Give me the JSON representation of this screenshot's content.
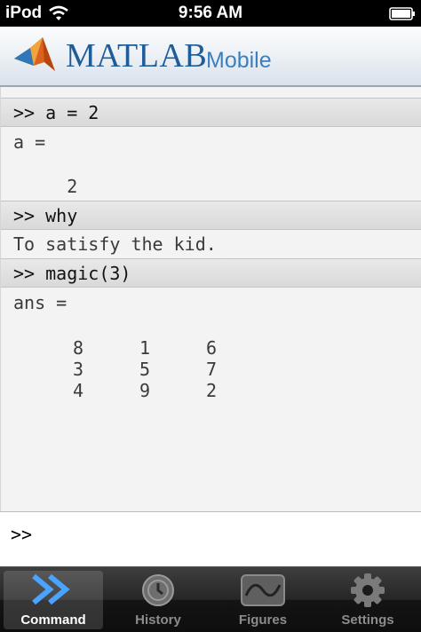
{
  "status_bar": {
    "carrier": "iPod",
    "time": "9:56 AM",
    "wifi_icon": "wifi-icon",
    "battery_icon": "battery-icon"
  },
  "header": {
    "title": "MATLAB",
    "subtitle": "Mobile",
    "logo_icon": "matlab-membrane-logo"
  },
  "console": {
    "entries": [
      {
        "command": ">> a = 2",
        "output": [
          "a =",
          "",
          "     2"
        ]
      },
      {
        "command": ">> why",
        "output": [
          "To satisfy the kid."
        ]
      },
      {
        "command": ">> magic(3)",
        "output_label": "ans =",
        "matrix": [
          [
            "8",
            "1",
            "6"
          ],
          [
            "3",
            "5",
            "7"
          ],
          [
            "4",
            "9",
            "2"
          ]
        ]
      }
    ]
  },
  "input": {
    "prompt": ">>",
    "value": ""
  },
  "tabs": [
    {
      "label": "Command",
      "icon": "command-chevrons-icon",
      "active": true
    },
    {
      "label": "History",
      "icon": "history-clock-icon",
      "active": false
    },
    {
      "label": "Figures",
      "icon": "figures-wave-icon",
      "active": false
    },
    {
      "label": "Settings",
      "icon": "settings-gear-icon",
      "active": false
    }
  ],
  "colors": {
    "accent": "#1f5d98",
    "tab_bar": "#1a1a1a",
    "console_bg": "#f3f3f3",
    "command_row_bg": "#dedede",
    "command_icon": "#4aa3ff"
  }
}
